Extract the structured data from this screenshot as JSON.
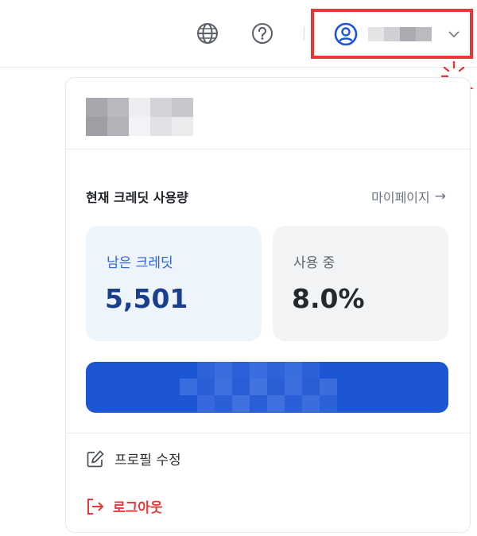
{
  "header": {
    "globe_icon": "globe-icon",
    "help_icon": "question-circle-icon",
    "account_icon": "user-circle-icon",
    "chevron_icon": "chevron-down-icon"
  },
  "panel": {
    "credit_title": "현재 크레딧 사용량",
    "mypage_label": "마이페이지",
    "mypage_arrow": "→",
    "remaining": {
      "label": "남은 크레딧",
      "value": "5,501"
    },
    "usage": {
      "label": "사용 중",
      "value": "8.0%"
    },
    "menu": {
      "edit_profile": "프로필 수정",
      "logout": "로그아웃"
    }
  },
  "colors": {
    "accent": "#1d56d5",
    "highlight": "#e53935",
    "logout": "#e53935",
    "remaining_card": "#eef4fc"
  }
}
